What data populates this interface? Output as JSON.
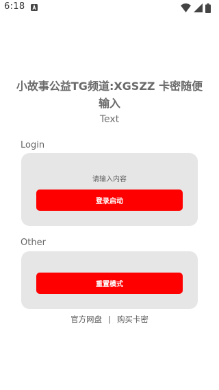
{
  "status_bar": {
    "time": "6:18",
    "notification_icon": "a-square-icon",
    "right_icons": [
      "wifi-icon",
      "signal-icon",
      "battery-icon"
    ]
  },
  "title": "小故事公益TG频道:XGSZZ 卡密随便输入",
  "subtitle": "Text",
  "login": {
    "section_label": "Login",
    "input_placeholder": "请输入内容",
    "input_value": "",
    "button_label": "登录启动"
  },
  "other": {
    "section_label": "Other",
    "button_label": "重置模式"
  },
  "footer": {
    "link_official": "官方网盘",
    "separator": "|",
    "link_buy": "购买卡密"
  },
  "colors": {
    "button": "#ff0000",
    "card_background": "#e6e6e6",
    "text": "#666666"
  }
}
